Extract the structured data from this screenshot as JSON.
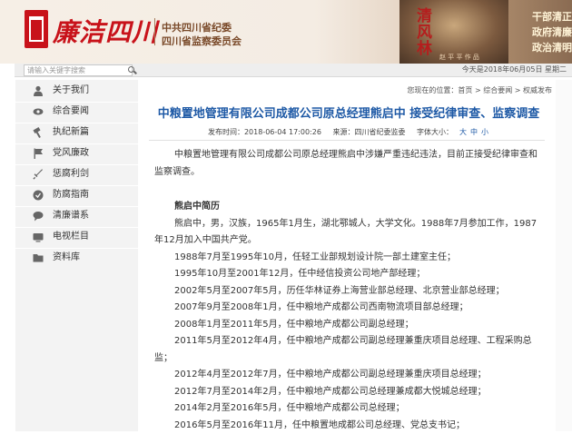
{
  "header": {
    "brand": "廉洁四川",
    "org_line1": "中共四川省纪委",
    "org_line2": "四川省监察委员会",
    "hero_title": "清风林",
    "hero_caption": "赵 平 平 作 品",
    "slogans": [
      "干部清正",
      "政府清廉",
      "政治清明"
    ]
  },
  "topbar": {
    "search_placeholder": "请输入关键字搜索",
    "date": "今天是2018年06月05日 星期二"
  },
  "sidebar": {
    "items": [
      {
        "label": "关于我们",
        "icon": "user-icon"
      },
      {
        "label": "综合要闻",
        "icon": "eye-icon"
      },
      {
        "label": "执纪新篇",
        "icon": "hammer-icon"
      },
      {
        "label": "党风廉政",
        "icon": "flag-icon"
      },
      {
        "label": "惩腐利剑",
        "icon": "sword-icon"
      },
      {
        "label": "防腐指南",
        "icon": "shield-icon"
      },
      {
        "label": "清廉谱系",
        "icon": "chat-icon"
      },
      {
        "label": "电视栏目",
        "icon": "tv-icon"
      },
      {
        "label": "资料库",
        "icon": "folder-icon"
      }
    ]
  },
  "article": {
    "breadcrumb": "您现在的位置：首页 > 综合要闻 > 权威发布",
    "title": "中粮置地管理有限公司成都公司原总经理熊启中 接受纪律审查、监察调查",
    "published": "发布时间：2018-06-04 17:00:26",
    "source": "来源：四川省纪委监委",
    "font_size_label": "字体大小：",
    "font_sizes": [
      "大",
      "中",
      "小"
    ],
    "intro": "中粮置地管理有限公司成都公司原总经理熊启中涉嫌严重违纪违法，目前正接受纪律审查和监察调查。",
    "bio_heading": "熊启中简历",
    "bio_intro": "熊启中，男，汉族，1965年1月生，湖北鄂城人，大学文化。1988年7月参加工作，1987年12月加入中国共产党。",
    "career": [
      "1988年7月至1995年10月，任轻工业部规划设计院一部土建室主任；",
      "1995年10月至2001年12月，任中经信投资公司地产部经理；",
      "2002年5月至2007年5月，历任华林证券上海营业部总经理、北京营业部总经理；",
      "2007年9月至2008年1月，任中粮地产成都公司西南物流项目部总经理；",
      "2008年1月至2011年5月，任中粮地产成都公司副总经理；",
      "2011年5月至2012年4月，任中粮地产成都公司副总经理兼重庆项目总经理、工程采购总监；",
      "2012年4月至2012年7月，任中粮地产成都公司副总经理兼重庆项目总经理；",
      "2012年7月至2014年2月，任中粮地产成都公司总经理兼成都大悦城总经理；",
      "2014年2月至2016年5月，任中粮地产成都公司总经理；",
      "2016年5月至2016年11月，任中粮置地成都公司总经理、党总支书记；"
    ]
  },
  "colors": {
    "brand_red": "#c8121a",
    "title_blue": "#1f5aa6"
  }
}
